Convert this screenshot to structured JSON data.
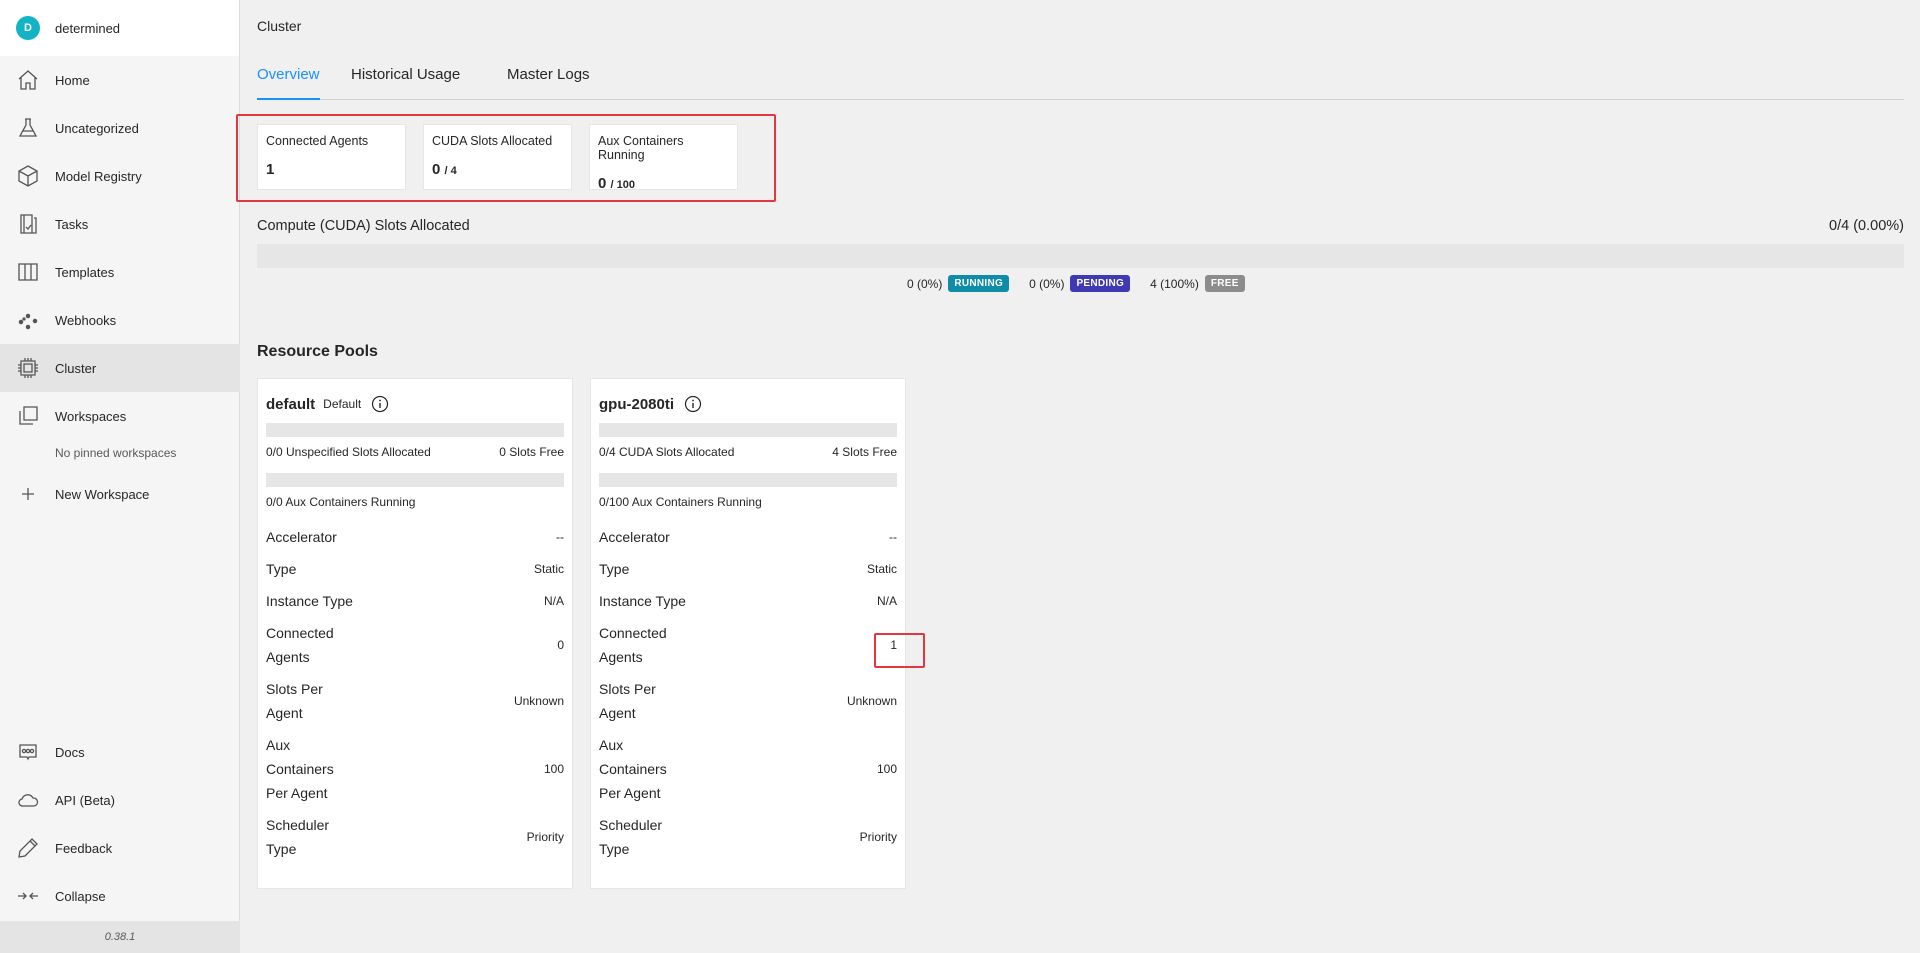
{
  "user": {
    "initial": "D",
    "name": "determined"
  },
  "nav": {
    "home": "Home",
    "uncategorized": "Uncategorized",
    "model_registry": "Model Registry",
    "tasks": "Tasks",
    "templates": "Templates",
    "webhooks": "Webhooks",
    "cluster": "Cluster",
    "workspaces": "Workspaces",
    "no_pinned": "No pinned workspaces",
    "new_workspace": "New Workspace",
    "docs": "Docs",
    "api": "API (Beta)",
    "feedback": "Feedback",
    "collapse": "Collapse"
  },
  "version": "0.38.1",
  "page": {
    "title": "Cluster",
    "tabs": [
      "Overview",
      "Historical Usage",
      "Master Logs"
    ],
    "active_tab": "Overview"
  },
  "stats": [
    {
      "label": "Connected Agents",
      "value": "1",
      "of": ""
    },
    {
      "label": "CUDA Slots Allocated",
      "value": "0",
      "of": "/ 4"
    },
    {
      "label": "Aux Containers Running",
      "value": "0",
      "of": "/ 100"
    }
  ],
  "compute": {
    "title": "Compute (CUDA) Slots Allocated",
    "summary": "0/4 (0.00%)",
    "allocated_fraction": 0,
    "legend": [
      {
        "count": "0 (0%)",
        "label": "RUNNING",
        "color": "#0e8ca8"
      },
      {
        "count": "0 (0%)",
        "label": "PENDING",
        "color": "#3f3ab3"
      },
      {
        "count": "4 (100%)",
        "label": "FREE",
        "color": "#8c8c8c"
      }
    ]
  },
  "resource_pools": {
    "title": "Resource Pools",
    "pools": [
      {
        "name": "default",
        "default_tag": "Default",
        "slots_allocated": "0/0 Unspecified Slots Allocated",
        "slots_free": "0 Slots Free",
        "aux_running": "0/0 Aux Containers Running",
        "accelerator_label": "Accelerator",
        "accelerator": "--",
        "type_label": "Type",
        "type": "Static",
        "instance_type_label": "Instance Type",
        "instance_type": "N/A",
        "connected_agents_label": "Connected Agents",
        "connected_agents": "0",
        "slots_per_agent_label": "Slots Per Agent",
        "slots_per_agent": "Unknown",
        "aux_per_agent_label": "Aux Containers Per Agent",
        "aux_per_agent": "100",
        "scheduler_label": "Scheduler Type",
        "scheduler": "Priority"
      },
      {
        "name": "gpu-2080ti",
        "default_tag": "",
        "slots_allocated": "0/4 CUDA Slots Allocated",
        "slots_free": "4 Slots Free",
        "aux_running": "0/100 Aux Containers Running",
        "accelerator_label": "Accelerator",
        "accelerator": "--",
        "type_label": "Type",
        "type": "Static",
        "instance_type_label": "Instance Type",
        "instance_type": "N/A",
        "connected_agents_label": "Connected Agents",
        "connected_agents": "1",
        "slots_per_agent_label": "Slots Per Agent",
        "slots_per_agent": "Unknown",
        "aux_per_agent_label": "Aux Containers Per Agent",
        "aux_per_agent": "100",
        "scheduler_label": "Scheduler Type",
        "scheduler": "Priority"
      }
    ]
  }
}
